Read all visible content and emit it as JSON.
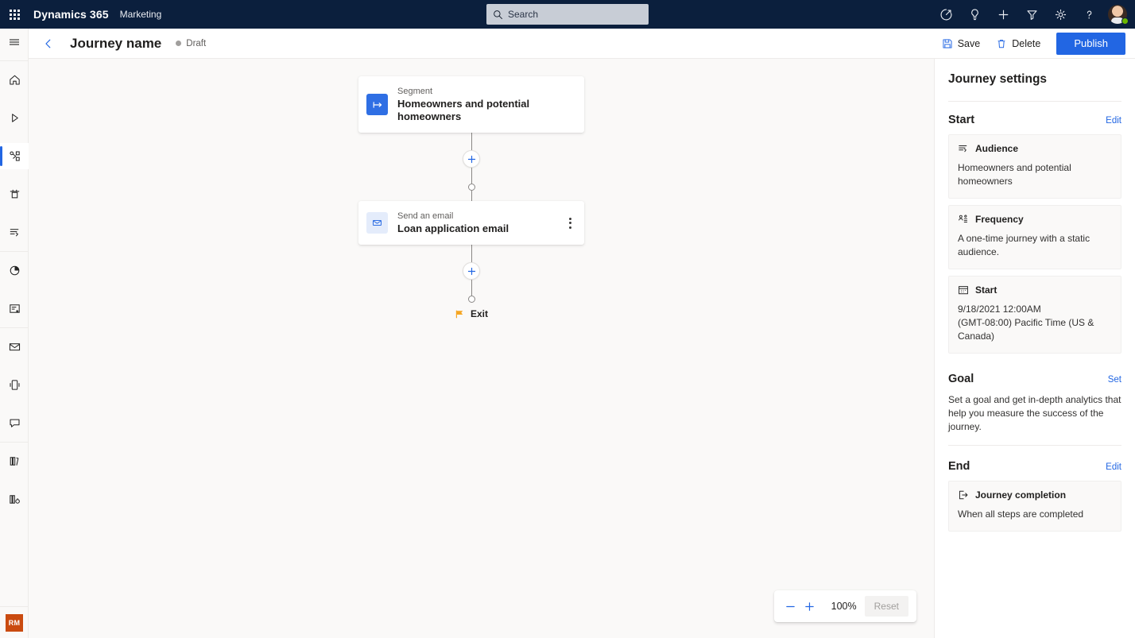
{
  "topbar": {
    "waffle_label": "app-launcher",
    "brand": "Dynamics 365",
    "app_name": "Marketing",
    "search_placeholder": "Search",
    "search_value": "",
    "icons": [
      {
        "name": "trial-icon",
        "label": "Trial"
      },
      {
        "name": "lightbulb-icon",
        "label": "Ideas"
      },
      {
        "name": "plus-icon",
        "label": "New"
      },
      {
        "name": "filter-icon",
        "label": "Filter"
      },
      {
        "name": "gear-icon",
        "label": "Settings"
      },
      {
        "name": "help-icon",
        "label": "Help"
      }
    ],
    "avatar_presence": "available"
  },
  "rail": {
    "items": [
      {
        "name": "hamburger-menu-icon",
        "label": "Expand navigation"
      },
      {
        "name": "home-icon",
        "label": "Home"
      },
      {
        "name": "recent-icon",
        "label": "Recent"
      },
      {
        "name": "journeys-icon",
        "label": "Journeys",
        "selected": true
      },
      {
        "name": "channels-icon",
        "label": "Channels"
      },
      {
        "name": "segments-icon",
        "label": "Segments"
      },
      {
        "name": "analytics-icon",
        "label": "Analytics"
      },
      {
        "name": "forms-icon",
        "label": "Forms"
      },
      {
        "name": "email-icon",
        "label": "Emails"
      },
      {
        "name": "push-notification-icon",
        "label": "Push notifications"
      },
      {
        "name": "text-message-icon",
        "label": "Text messages"
      },
      {
        "name": "library-icon",
        "label": "Library"
      },
      {
        "name": "settings-columns-icon",
        "label": "Settings"
      }
    ],
    "user_initials": "RM"
  },
  "commandbar": {
    "back_label": "Back",
    "title": "Journey name",
    "status": "Draft",
    "save_label": "Save",
    "delete_label": "Delete",
    "publish_label": "Publish"
  },
  "canvas": {
    "nodes": [
      {
        "id": "segment-node",
        "kind": "Segment",
        "name": "Homeowners and potential homeowners",
        "icon": "segment-icon",
        "icon_color": "#2f6fe4",
        "has_more_menu": false
      },
      {
        "id": "email-node",
        "kind": "Send an email",
        "name": "Loan application email",
        "icon": "envelope-icon",
        "icon_color": "#e4ecfb",
        "has_more_menu": true
      }
    ],
    "add_button_label": "Add step",
    "exit_label": "Exit",
    "exit_flag_color": "#f5a623",
    "zoom": {
      "zoom_out_label": "Zoom out",
      "zoom_in_label": "Zoom in",
      "level": "100%",
      "reset_label": "Reset"
    }
  },
  "panel": {
    "title": "Journey settings",
    "sections": [
      {
        "id": "start",
        "title": "Start",
        "link": "Edit",
        "cards": [
          {
            "id": "audience",
            "icon": "audience-icon",
            "heading": "Audience",
            "body": "Homeowners and potential homeowners"
          },
          {
            "id": "frequency",
            "icon": "frequency-icon",
            "heading": "Frequency",
            "body": "A one-time journey with a static audience."
          },
          {
            "id": "start-date",
            "icon": "calendar-icon",
            "heading": "Start",
            "body_line1": "9/18/2021 12:00AM",
            "body_line2": "(GMT-08:00) Pacific Time (US & Canada)"
          }
        ]
      },
      {
        "id": "goal",
        "title": "Goal",
        "link": "Set",
        "description": "Set a goal and get in-depth analytics that help you measure the success of the journey."
      },
      {
        "id": "end",
        "title": "End",
        "link": "Edit",
        "cards": [
          {
            "id": "journey-completion",
            "icon": "exit-door-icon",
            "heading": "Journey completion",
            "body": "When all steps are completed"
          }
        ]
      }
    ]
  },
  "colors": {
    "brand_navy": "#0b1f3d",
    "accent_blue": "#2266e3",
    "canvas_bg": "#faf9f8",
    "exit_orange": "#f5a623",
    "user_tile": "#ca4b10"
  }
}
